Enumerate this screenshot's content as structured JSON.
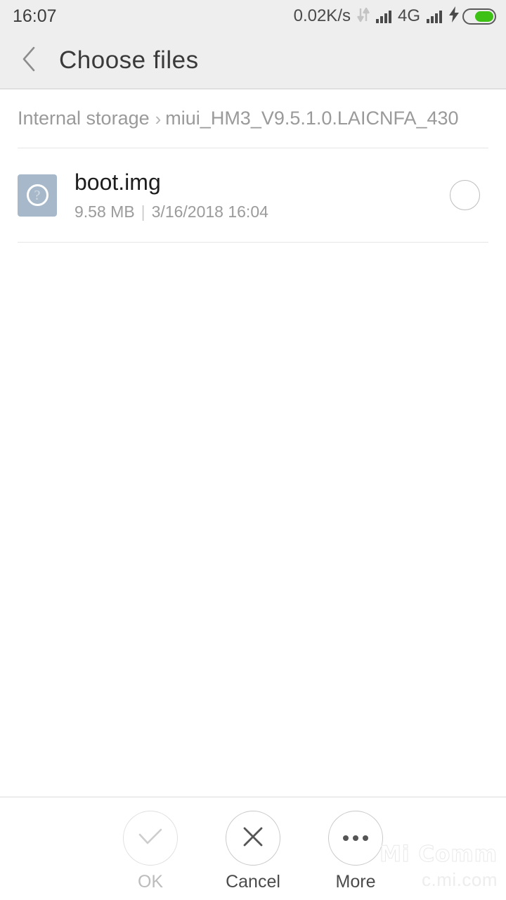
{
  "statusbar": {
    "clock": "16:07",
    "network_speed": "0.02K/s",
    "data_sync_icon": "data-transfer-arrows-icon",
    "signal_icon_1": "signal-bars-icon",
    "network_type": "4G",
    "signal_icon_2": "signal-bars-icon",
    "charging_icon": "lightning-bolt-icon",
    "battery_icon": "battery-icon",
    "battery_level_percent": 64
  },
  "titlebar": {
    "back_icon": "back-chevron-icon",
    "title": "Choose  files"
  },
  "breadcrumb": {
    "root_label": "Internal storage",
    "separator": "›",
    "current_label": "miui_HM3_V9.5.1.0.LAICNFA_430"
  },
  "files": [
    {
      "icon": "unknown-file-icon",
      "icon_glyph": "?",
      "icon_color": "#a6b8c9",
      "name": "boot.img",
      "size": "9.58 MB",
      "meta_separator": "|",
      "date": "3/16/2018 16:04",
      "selected": false
    }
  ],
  "toolbar": {
    "buttons": [
      {
        "label": "OK",
        "icon": "check-icon",
        "enabled": false
      },
      {
        "label": "Cancel",
        "icon": "close-x-icon",
        "enabled": true
      },
      {
        "label": "More",
        "icon": "ellipsis-icon",
        "enabled": true
      }
    ]
  },
  "watermark": {
    "line1": "Mi Comm",
    "line2": "c.mi.com"
  }
}
